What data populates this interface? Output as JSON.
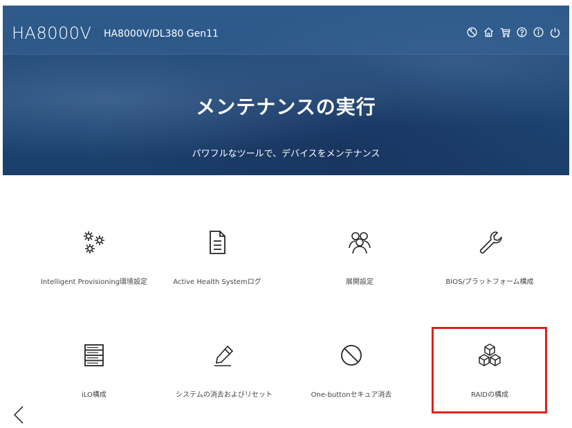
{
  "header": {
    "brand": "HA8000V",
    "model": "HA8000V/DL380 Gen11",
    "icons": [
      "power-schedule-icon",
      "home-icon",
      "cart-icon",
      "help-icon",
      "info-icon",
      "power-icon"
    ]
  },
  "hero": {
    "title": "メンテナンスの実行",
    "subtitle": "パワフルなツールで、デバイスをメンテナンス"
  },
  "tiles": [
    {
      "label": "Intelligent Provisioning環境設定",
      "icon": "gears-icon"
    },
    {
      "label": "Active Health Systemログ",
      "icon": "document-icon"
    },
    {
      "label": "展開設定",
      "icon": "users-icon"
    },
    {
      "label": "BIOS/プラットフォーム構成",
      "icon": "wrench-icon"
    },
    {
      "label": "iLO構成",
      "icon": "server-icon"
    },
    {
      "label": "システムの消去およびリセット",
      "icon": "eraser-icon"
    },
    {
      "label": "One-buttonセキュア消去",
      "icon": "prohibited-icon"
    },
    {
      "label": "RAIDの構成",
      "icon": "cubes-icon"
    }
  ],
  "highlight_color": "#e0211f",
  "nav": {
    "back_icon": "chevron-left-icon"
  }
}
